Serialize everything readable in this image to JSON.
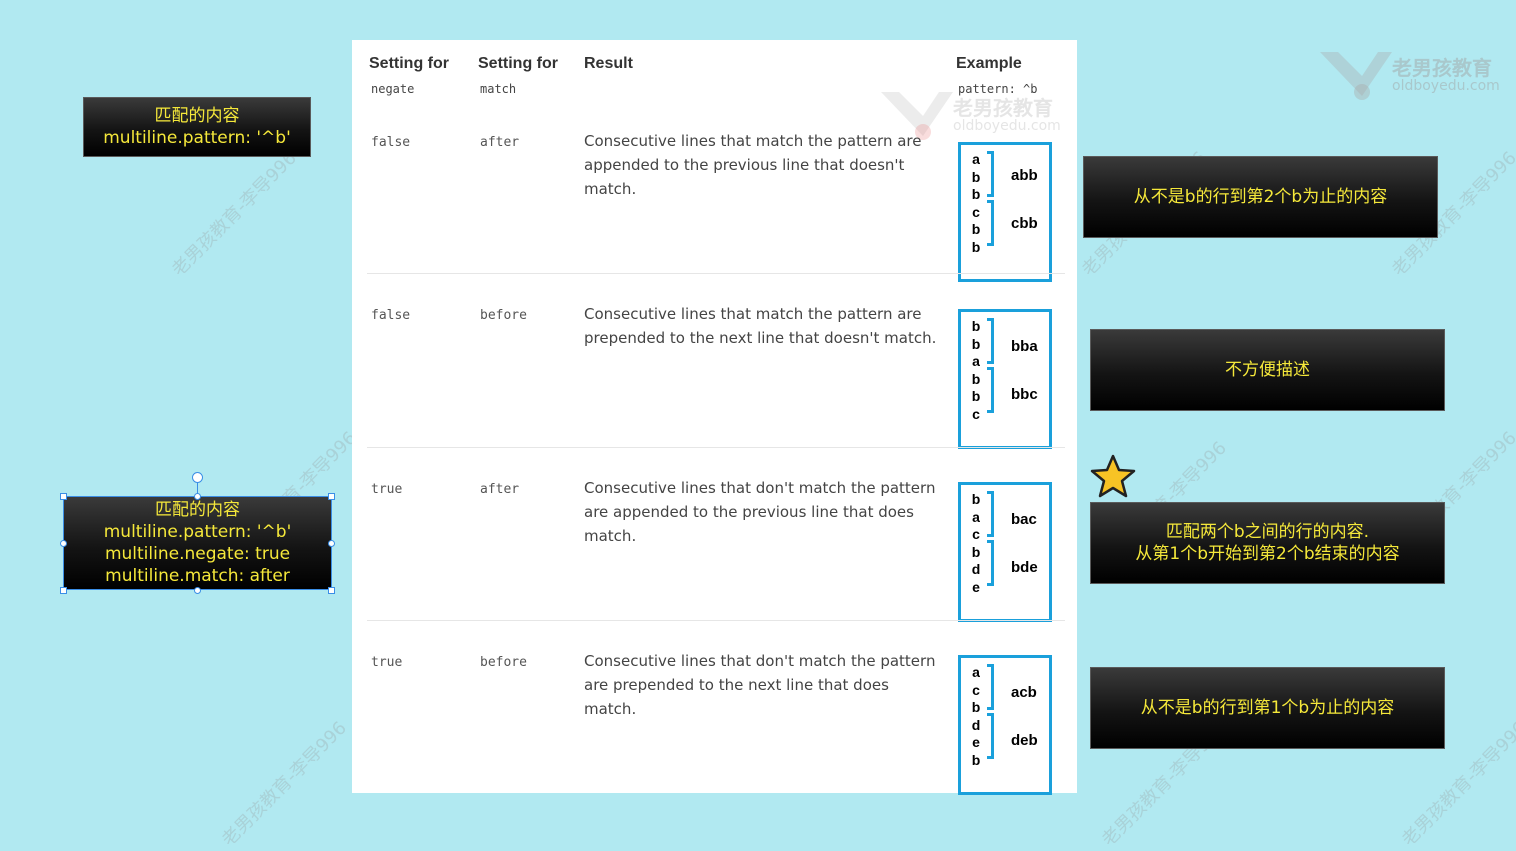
{
  "table": {
    "headers": {
      "negate_title": "Setting for",
      "negate_code": "negate",
      "match_title": "Setting for",
      "match_code": "match",
      "result": "Result",
      "example_title": "Example",
      "example_pattern": "pattern: ^b"
    },
    "rows": [
      {
        "negate": "false",
        "match": "after",
        "result": "Consecutive lines that match the pattern are appended to the previous line that doesn't match.",
        "letters": [
          "a",
          "b",
          "b",
          "c",
          "b",
          "b"
        ],
        "group1": "abb",
        "group2": "cbb"
      },
      {
        "negate": "false",
        "match": "before",
        "result": "Consecutive lines that match the pattern are prepended to the next line that doesn't match.",
        "letters": [
          "b",
          "b",
          "a",
          "b",
          "b",
          "c"
        ],
        "group1": "bba",
        "group2": "bbc"
      },
      {
        "negate": "true",
        "match": "after",
        "result": "Consecutive lines that don't match the pattern are appended to the previous line that does match.",
        "letters": [
          "b",
          "a",
          "c",
          "b",
          "d",
          "e"
        ],
        "group1": "bac",
        "group2": "bde"
      },
      {
        "negate": "true",
        "match": "before",
        "result": "Consecutive lines that don't match the pattern are prepended to the next line that does match.",
        "letters": [
          "a",
          "c",
          "b",
          "d",
          "e",
          "b"
        ],
        "group1": "acb",
        "group2": "deb"
      }
    ]
  },
  "notes": {
    "left_top": {
      "line1": "匹配的内容",
      "line2": "multiline.pattern: '^b'"
    },
    "left_bottom": {
      "line1": "匹配的内容",
      "line2": "multiline.pattern: '^b'",
      "line3": "multiline.negate: true",
      "line4": "multiline.match: after"
    },
    "right_1": "从不是b的行到第2个b为止的内容",
    "right_2": "不方便描述",
    "right_3": {
      "line1": "匹配两个b之间的行的内容.",
      "line2": "从第1个b开始到第2个b结束的内容"
    },
    "right_4": "从不是b的行到第1个b为止的内容"
  },
  "watermark": {
    "brand": "老男孩教育",
    "site": "oldboyedu.com",
    "diag": "老男孩教育-李导996"
  },
  "colors": {
    "background": "#b1e9f1",
    "example_border": "#1aa0db",
    "note_text": "#f5e83a",
    "star_fill": "#f7c325"
  },
  "icons": {
    "star": "star-icon",
    "logo": "oldboy-logo-icon"
  }
}
